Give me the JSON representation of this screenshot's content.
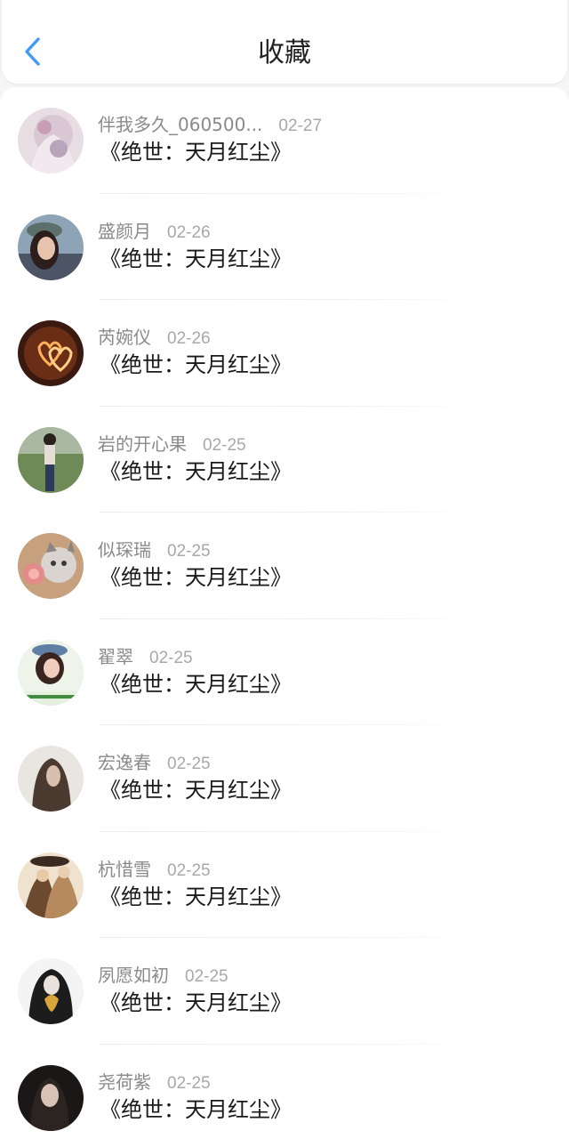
{
  "header": {
    "title": "收藏",
    "back_icon": "chevron-left-icon",
    "accent_color": "#3f9bf7"
  },
  "items": [
    {
      "user": "伴我多久_060500...",
      "date": "02-27",
      "book": "《绝世：天月红尘》",
      "avatar": "anime-girl-avatar"
    },
    {
      "user": "盛颜月",
      "date": "02-26",
      "book": "《绝世：天月红尘》",
      "avatar": "girl-with-cap-avatar"
    },
    {
      "user": "芮婉仪",
      "date": "02-26",
      "book": "《绝世：天月红尘》",
      "avatar": "candle-hearts-avatar"
    },
    {
      "user": "岩的开心果",
      "date": "02-25",
      "book": "《绝世：天月红尘》",
      "avatar": "standing-girl-avatar"
    },
    {
      "user": "似琛瑞",
      "date": "02-25",
      "book": "《绝世：天月红尘》",
      "avatar": "cat-with-flower-avatar"
    },
    {
      "user": "翟翠",
      "date": "02-25",
      "book": "《绝世：天月红尘》",
      "avatar": "girl-with-hat-avatar"
    },
    {
      "user": "宏逸春",
      "date": "02-25",
      "book": "《绝世：天月红尘》",
      "avatar": "long-hair-girl-avatar"
    },
    {
      "user": "杭惜雪",
      "date": "02-25",
      "book": "《绝世：天月红尘》",
      "avatar": "ancient-couple-avatar"
    },
    {
      "user": "夙愿如初",
      "date": "02-25",
      "book": "《绝世：天月红尘》",
      "avatar": "girl-with-leaf-avatar"
    },
    {
      "user": "尧荷紫",
      "date": "02-25",
      "book": "《绝世：天月红尘》",
      "avatar": "dark-hair-girl-avatar"
    }
  ]
}
